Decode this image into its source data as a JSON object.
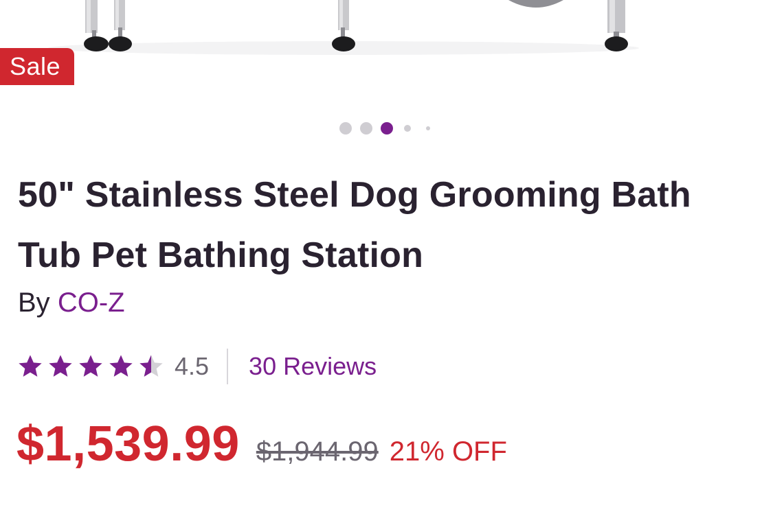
{
  "badge": {
    "sale_label": "Sale"
  },
  "carousel": {
    "total_dots": 5,
    "active_index": 2
  },
  "product": {
    "title": "50\" Stainless Steel Dog Grooming Bath Tub Pet Bathing Station",
    "brand_prefix": "By",
    "brand_name": "CO-Z"
  },
  "rating": {
    "value": "4.5",
    "stars_out_of": 5,
    "reviews_label": "30 Reviews"
  },
  "pricing": {
    "sale_price": "$1,539.99",
    "original_price": "$1,944.99",
    "discount_label": "21% OFF"
  },
  "colors": {
    "accent_purple": "#7a1f8e",
    "sale_red": "#d0272f",
    "text_dark": "#2a2230",
    "text_gray": "#6b6670"
  }
}
